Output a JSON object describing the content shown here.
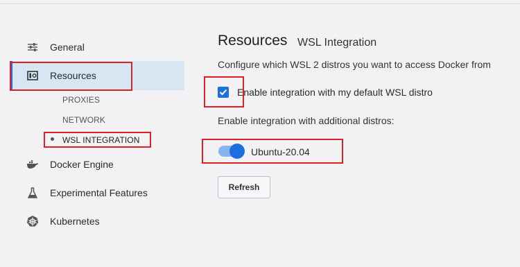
{
  "sidebar": {
    "items": [
      {
        "label": "General",
        "icon": "sliders-icon"
      },
      {
        "label": "Resources",
        "icon": "resources-icon"
      },
      {
        "label": "Docker Engine",
        "icon": "whale-icon"
      },
      {
        "label": "Experimental Features",
        "icon": "flask-icon"
      },
      {
        "label": "Kubernetes",
        "icon": "kubernetes-icon"
      }
    ],
    "subitems": [
      "PROXIES",
      "NETWORK",
      "WSL INTEGRATION"
    ]
  },
  "main": {
    "title": "Resources",
    "subtitle": "WSL Integration",
    "description": "Configure which WSL 2 distros you want to access Docker from",
    "default_integration_label": "Enable integration with my default WSL distro",
    "default_integration_checked": true,
    "additional_label": "Enable integration with additional distros:",
    "distros": [
      {
        "label": "Ubuntu-20.04",
        "enabled": true
      }
    ],
    "refresh_label": "Refresh"
  },
  "colors": {
    "accent": "#1d6fe0",
    "annotation": "#e02020",
    "active_bg": "#d6e6f3"
  }
}
